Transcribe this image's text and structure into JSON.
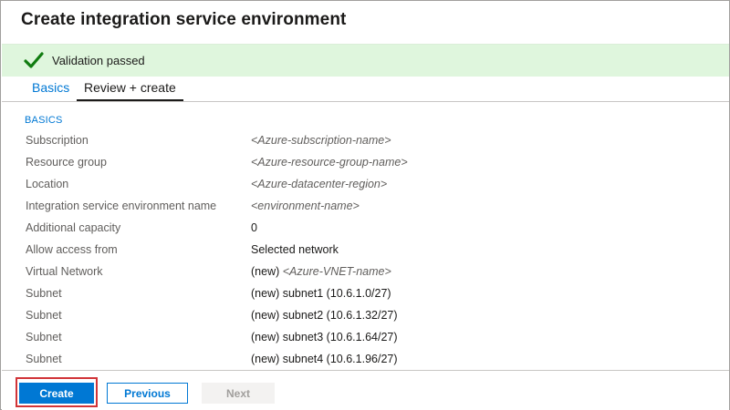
{
  "title": "Create integration service environment",
  "validation": {
    "message": "Validation passed",
    "icon": "checkmark-icon",
    "color": "#dff6dd",
    "icon_color": "#107c10"
  },
  "tabs": [
    {
      "label": "Basics",
      "active": false
    },
    {
      "label": "Review + create",
      "active": true
    }
  ],
  "section": {
    "heading": "BASICS",
    "rows": [
      {
        "label": "Subscription",
        "prefix": "",
        "value": "<Azure-subscription-name>",
        "placeholder": true
      },
      {
        "label": "Resource group",
        "prefix": "",
        "value": "<Azure-resource-group-name>",
        "placeholder": true
      },
      {
        "label": "Location",
        "prefix": "",
        "value": "<Azure-datacenter-region>",
        "placeholder": true
      },
      {
        "label": "Integration service environment name",
        "prefix": "",
        "value": "<environment-name>",
        "placeholder": true
      },
      {
        "label": "Additional capacity",
        "prefix": "",
        "value": "0",
        "placeholder": false
      },
      {
        "label": "Allow access from",
        "prefix": "",
        "value": "Selected network",
        "placeholder": false
      },
      {
        "label": "Virtual Network",
        "prefix": "(new) ",
        "value": "<Azure-VNET-name>",
        "placeholder": true
      },
      {
        "label": "Subnet",
        "prefix": "",
        "value": "(new) subnet1 (10.6.1.0/27)",
        "placeholder": false
      },
      {
        "label": "Subnet",
        "prefix": "",
        "value": "(new) subnet2 (10.6.1.32/27)",
        "placeholder": false
      },
      {
        "label": "Subnet",
        "prefix": "",
        "value": "(new) subnet3 (10.6.1.64/27)",
        "placeholder": false
      },
      {
        "label": "Subnet",
        "prefix": "",
        "value": "(new) subnet4 (10.6.1.96/27)",
        "placeholder": false
      }
    ]
  },
  "footer": {
    "create_label": "Create",
    "previous_label": "Previous",
    "next_label": "Next",
    "create_color": "#0078d4",
    "highlight_color": "#d13438"
  }
}
